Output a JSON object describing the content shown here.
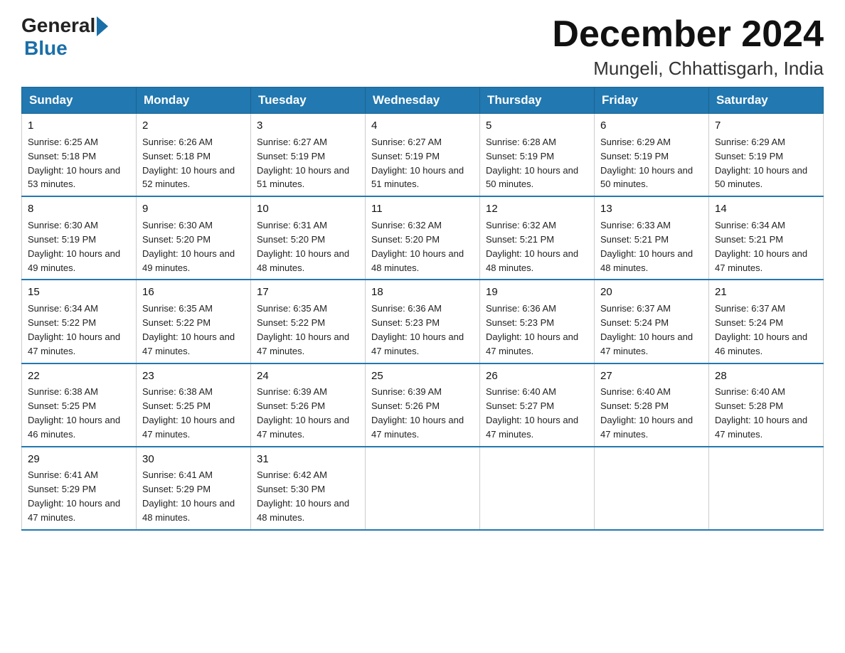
{
  "header": {
    "logo_general": "General",
    "logo_blue": "Blue",
    "title": "December 2024",
    "subtitle": "Mungeli, Chhattisgarh, India"
  },
  "days_of_week": [
    "Sunday",
    "Monday",
    "Tuesday",
    "Wednesday",
    "Thursday",
    "Friday",
    "Saturday"
  ],
  "weeks": [
    [
      {
        "day": "1",
        "sunrise": "6:25 AM",
        "sunset": "5:18 PM",
        "daylight": "10 hours and 53 minutes."
      },
      {
        "day": "2",
        "sunrise": "6:26 AM",
        "sunset": "5:18 PM",
        "daylight": "10 hours and 52 minutes."
      },
      {
        "day": "3",
        "sunrise": "6:27 AM",
        "sunset": "5:19 PM",
        "daylight": "10 hours and 51 minutes."
      },
      {
        "day": "4",
        "sunrise": "6:27 AM",
        "sunset": "5:19 PM",
        "daylight": "10 hours and 51 minutes."
      },
      {
        "day": "5",
        "sunrise": "6:28 AM",
        "sunset": "5:19 PM",
        "daylight": "10 hours and 50 minutes."
      },
      {
        "day": "6",
        "sunrise": "6:29 AM",
        "sunset": "5:19 PM",
        "daylight": "10 hours and 50 minutes."
      },
      {
        "day": "7",
        "sunrise": "6:29 AM",
        "sunset": "5:19 PM",
        "daylight": "10 hours and 50 minutes."
      }
    ],
    [
      {
        "day": "8",
        "sunrise": "6:30 AM",
        "sunset": "5:19 PM",
        "daylight": "10 hours and 49 minutes."
      },
      {
        "day": "9",
        "sunrise": "6:30 AM",
        "sunset": "5:20 PM",
        "daylight": "10 hours and 49 minutes."
      },
      {
        "day": "10",
        "sunrise": "6:31 AM",
        "sunset": "5:20 PM",
        "daylight": "10 hours and 48 minutes."
      },
      {
        "day": "11",
        "sunrise": "6:32 AM",
        "sunset": "5:20 PM",
        "daylight": "10 hours and 48 minutes."
      },
      {
        "day": "12",
        "sunrise": "6:32 AM",
        "sunset": "5:21 PM",
        "daylight": "10 hours and 48 minutes."
      },
      {
        "day": "13",
        "sunrise": "6:33 AM",
        "sunset": "5:21 PM",
        "daylight": "10 hours and 48 minutes."
      },
      {
        "day": "14",
        "sunrise": "6:34 AM",
        "sunset": "5:21 PM",
        "daylight": "10 hours and 47 minutes."
      }
    ],
    [
      {
        "day": "15",
        "sunrise": "6:34 AM",
        "sunset": "5:22 PM",
        "daylight": "10 hours and 47 minutes."
      },
      {
        "day": "16",
        "sunrise": "6:35 AM",
        "sunset": "5:22 PM",
        "daylight": "10 hours and 47 minutes."
      },
      {
        "day": "17",
        "sunrise": "6:35 AM",
        "sunset": "5:22 PM",
        "daylight": "10 hours and 47 minutes."
      },
      {
        "day": "18",
        "sunrise": "6:36 AM",
        "sunset": "5:23 PM",
        "daylight": "10 hours and 47 minutes."
      },
      {
        "day": "19",
        "sunrise": "6:36 AM",
        "sunset": "5:23 PM",
        "daylight": "10 hours and 47 minutes."
      },
      {
        "day": "20",
        "sunrise": "6:37 AM",
        "sunset": "5:24 PM",
        "daylight": "10 hours and 47 minutes."
      },
      {
        "day": "21",
        "sunrise": "6:37 AM",
        "sunset": "5:24 PM",
        "daylight": "10 hours and 46 minutes."
      }
    ],
    [
      {
        "day": "22",
        "sunrise": "6:38 AM",
        "sunset": "5:25 PM",
        "daylight": "10 hours and 46 minutes."
      },
      {
        "day": "23",
        "sunrise": "6:38 AM",
        "sunset": "5:25 PM",
        "daylight": "10 hours and 47 minutes."
      },
      {
        "day": "24",
        "sunrise": "6:39 AM",
        "sunset": "5:26 PM",
        "daylight": "10 hours and 47 minutes."
      },
      {
        "day": "25",
        "sunrise": "6:39 AM",
        "sunset": "5:26 PM",
        "daylight": "10 hours and 47 minutes."
      },
      {
        "day": "26",
        "sunrise": "6:40 AM",
        "sunset": "5:27 PM",
        "daylight": "10 hours and 47 minutes."
      },
      {
        "day": "27",
        "sunrise": "6:40 AM",
        "sunset": "5:28 PM",
        "daylight": "10 hours and 47 minutes."
      },
      {
        "day": "28",
        "sunrise": "6:40 AM",
        "sunset": "5:28 PM",
        "daylight": "10 hours and 47 minutes."
      }
    ],
    [
      {
        "day": "29",
        "sunrise": "6:41 AM",
        "sunset": "5:29 PM",
        "daylight": "10 hours and 47 minutes."
      },
      {
        "day": "30",
        "sunrise": "6:41 AM",
        "sunset": "5:29 PM",
        "daylight": "10 hours and 48 minutes."
      },
      {
        "day": "31",
        "sunrise": "6:42 AM",
        "sunset": "5:30 PM",
        "daylight": "10 hours and 48 minutes."
      },
      null,
      null,
      null,
      null
    ]
  ]
}
